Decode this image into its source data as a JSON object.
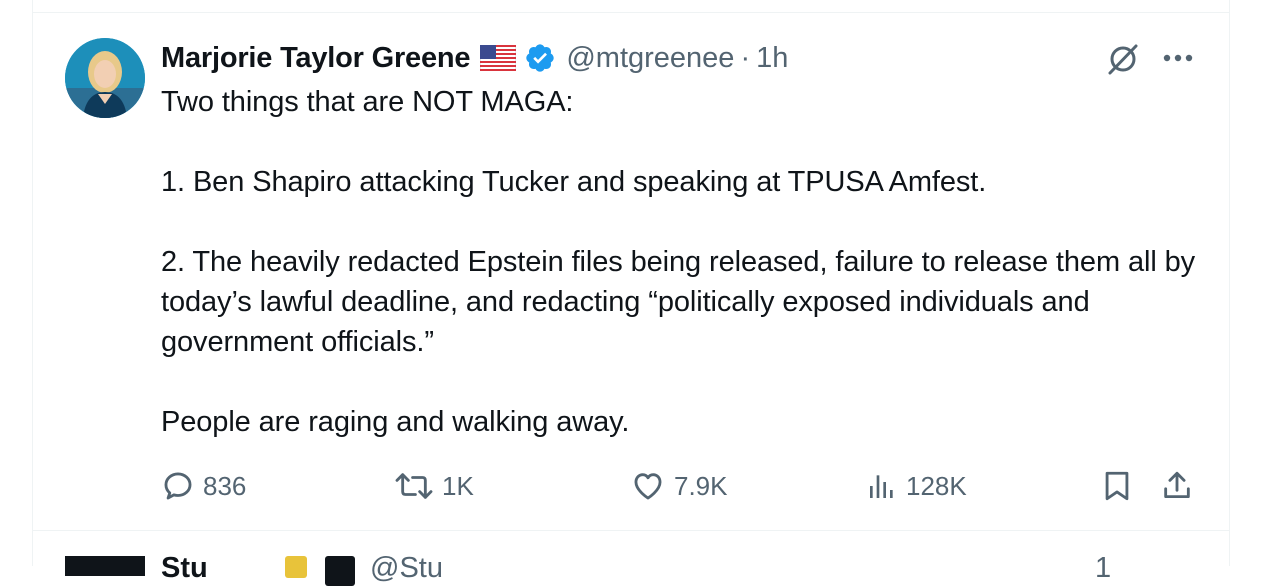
{
  "tweet": {
    "author_name": "Marjorie Taylor Greene",
    "handle": "@mtgreenee",
    "separator": "·",
    "time": "1h",
    "text": "Two things that are NOT MAGA:\n\n1. Ben Shapiro attacking Tucker and speaking at TPUSA Amfest.\n\n2. The heavily redacted Epstein files being released, failure to release them all by today’s lawful deadline, and redacting “politically exposed individuals and government officials.”\n\nPeople are raging and walking away.",
    "icons": {
      "flag": "us-flag-icon",
      "verified": "verified-badge-icon",
      "grok": "grok-icon",
      "more": "more-icon"
    },
    "actions": {
      "replies": "836",
      "reposts": "1K",
      "likes": "7.9K",
      "views": "128K"
    }
  },
  "next_tweet": {
    "author_name": "Stu",
    "handle": "@Stu",
    "time": "1"
  },
  "colors": {
    "text": "#0f1419",
    "secondary": "#536471",
    "verified": "#1d9bf0",
    "border": "#eff3f4"
  }
}
